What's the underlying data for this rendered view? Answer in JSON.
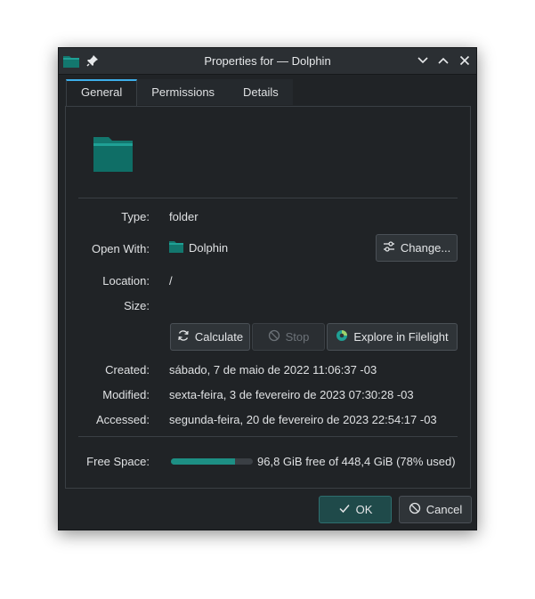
{
  "window": {
    "title": "Properties for — Dolphin"
  },
  "tabs": [
    {
      "label": "General",
      "active": true
    },
    {
      "label": "Permissions",
      "active": false
    },
    {
      "label": "Details",
      "active": false
    }
  ],
  "general": {
    "type_label": "Type:",
    "type_value": "folder",
    "open_with_label": "Open With:",
    "open_with_value": "Dolphin",
    "change_button": "Change...",
    "location_label": "Location:",
    "location_value": "/",
    "size_label": "Size:",
    "calculate_button": "Calculate",
    "stop_button": "Stop",
    "filelight_button": "Explore in Filelight",
    "created_label": "Created:",
    "created_value": "sábado, 7 de maio de 2022 11:06:37 -03",
    "modified_label": "Modified:",
    "modified_value": "sexta-feira, 3 de fevereiro de 2023 07:30:28 -03",
    "accessed_label": "Accessed:",
    "accessed_value": "segunda-feira, 20 de fevereiro de 2023 22:54:17 -03",
    "free_space_label": "Free Space:",
    "free_space_value": "96,8 GiB free of 448,4 GiB (78% used)",
    "used_fraction": 0.78
  },
  "footer": {
    "ok_button": "OK",
    "cancel_button": "Cancel"
  },
  "colors": {
    "accent": "#3daee9",
    "teal": "#1d8f84",
    "folder": "#13776e"
  },
  "icons": [
    "folder-icon",
    "pin-icon",
    "minimize-icon",
    "maximize-icon",
    "close-icon",
    "settings-icon",
    "refresh-icon",
    "stop-icon",
    "filelight-icon",
    "check-icon",
    "cancel-icon"
  ]
}
